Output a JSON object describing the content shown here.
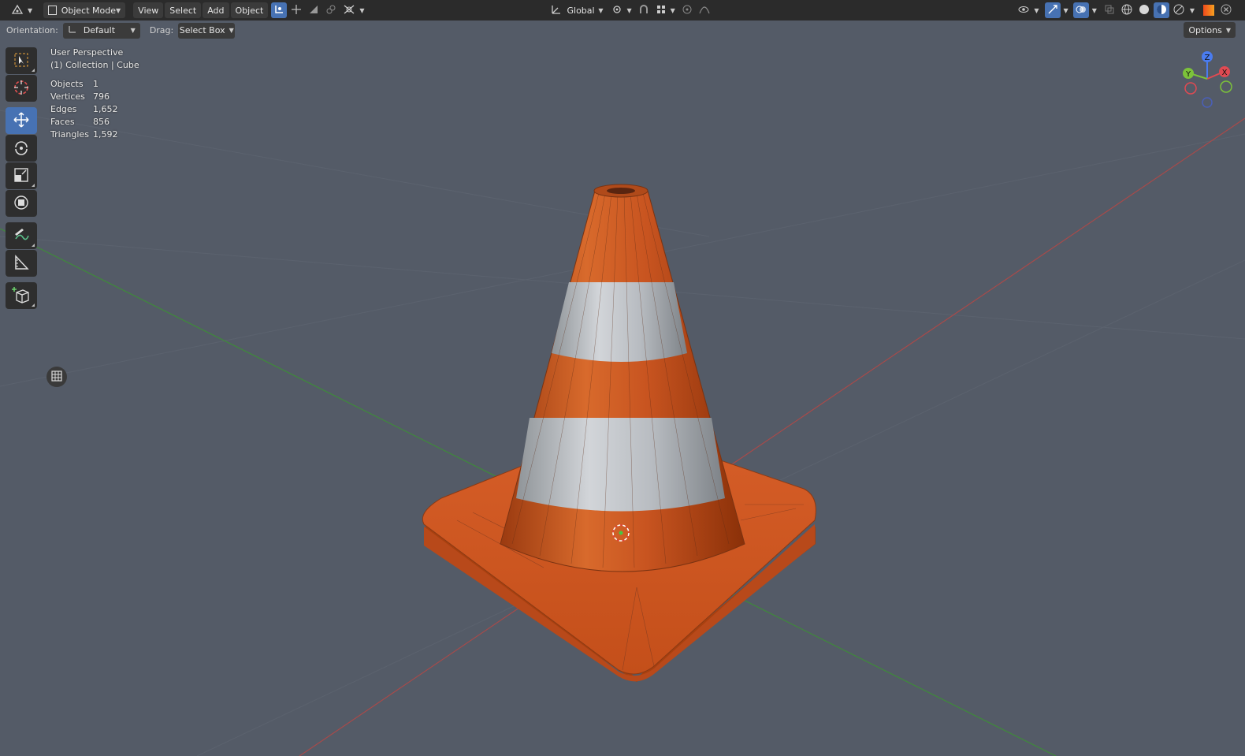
{
  "header": {
    "editor_type_icon": "object-mode-icon",
    "mode_label": "Object Mode",
    "menus": [
      "View",
      "Select",
      "Add",
      "Object"
    ],
    "transform_orientation": "Global",
    "colors": {
      "bar": "#2b2b2b",
      "button": "#3b3b3b",
      "active": "#4772b3"
    }
  },
  "toolsettings": {
    "orientation_label": "Orientation:",
    "orientation_value": "Default",
    "drag_label": "Drag:",
    "drag_value": "Select Box",
    "options_label": "Options"
  },
  "overlay": {
    "view_name": "User Perspective",
    "collection_label": "(1) Collection | Cube",
    "stats": [
      {
        "key": "Objects",
        "value": "1"
      },
      {
        "key": "Vertices",
        "value": "796"
      },
      {
        "key": "Edges",
        "value": "1,652"
      },
      {
        "key": "Faces",
        "value": "856"
      },
      {
        "key": "Triangles",
        "value": "1,592"
      }
    ]
  },
  "gizmo": {
    "x": "X",
    "y": "Y",
    "z": "Z",
    "colors": {
      "x": "#e04a52",
      "y": "#7cc23a",
      "z": "#4a7cf0"
    }
  },
  "toolbar_icons": [
    "select-box-icon",
    "cursor-icon",
    "move-icon",
    "rotate-icon",
    "scale-icon",
    "transform-icon",
    "annotate-icon",
    "measure-icon",
    "add-cube-icon"
  ],
  "scene": {
    "cone_orange": "#d3541d",
    "stripe_white": "#b9bdc2",
    "grid_red": "#a84a4a",
    "grid_green": "#3f8a3a"
  }
}
